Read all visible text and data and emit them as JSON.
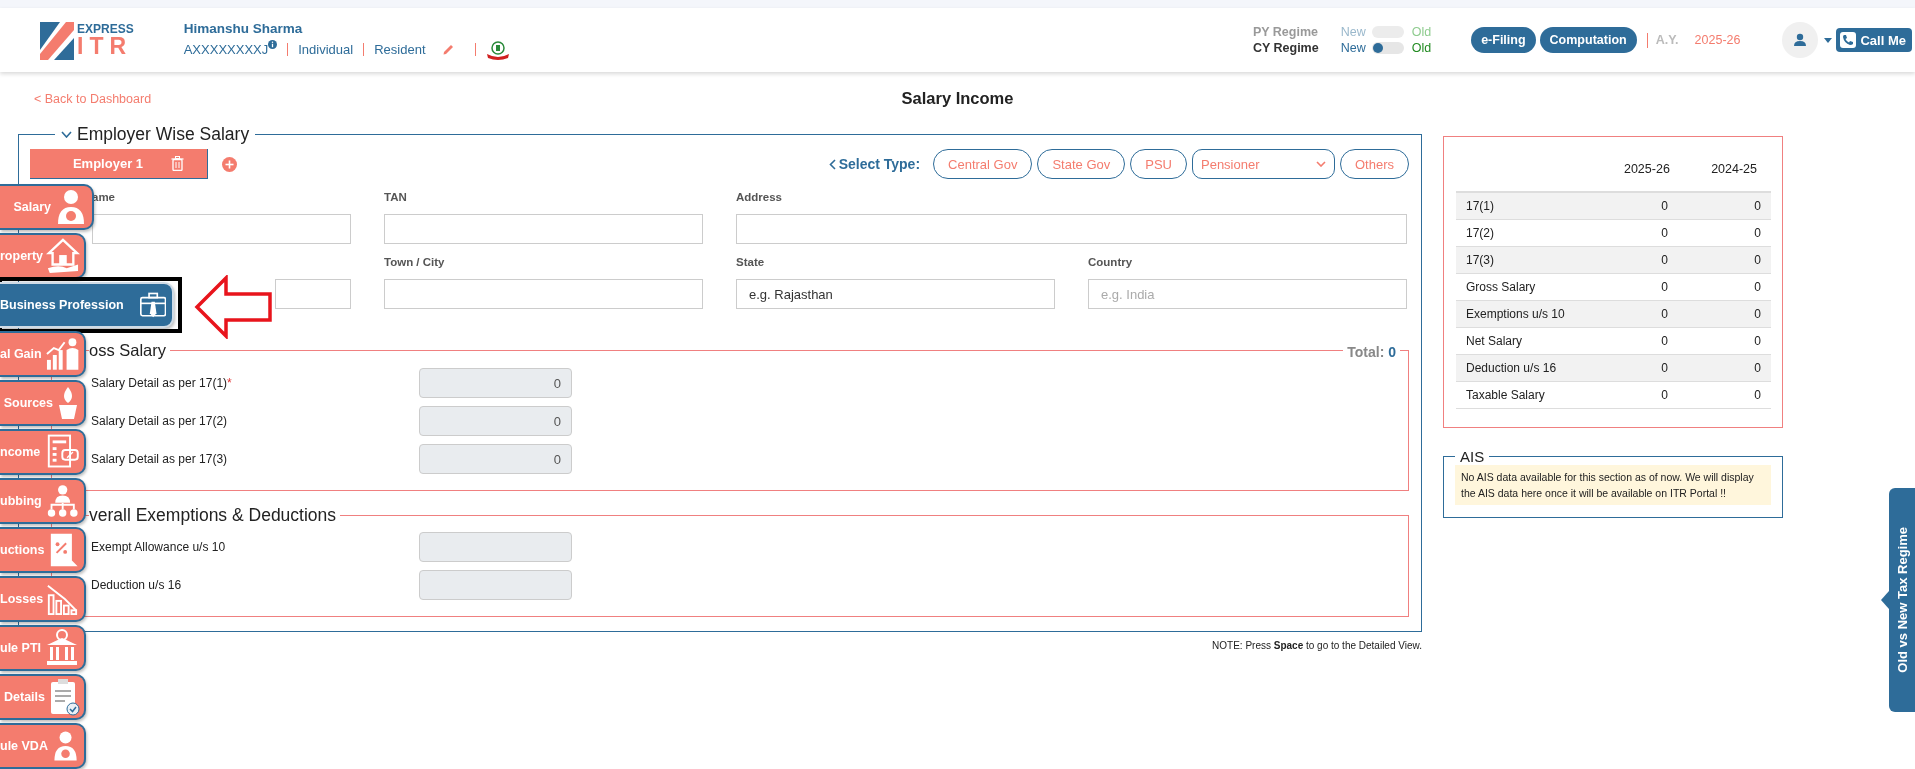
{
  "header": {
    "logo": {
      "line_1": "EXPRESS",
      "line_2": "ITR"
    },
    "user": {
      "name": "Himanshu Sharma",
      "pan": "AXXXXXXXXJ",
      "status": "Individual",
      "residency": "Resident"
    },
    "regimes": [
      {
        "label": "PY Regime",
        "new_label": "New",
        "old_label": "Old",
        "disabled": true
      },
      {
        "label": "CY Regime",
        "new_label": "New",
        "old_label": "Old",
        "disabled": false,
        "old_selected": false
      }
    ],
    "buttons": [
      "e-Filing",
      "Computation"
    ],
    "assessment_year": {
      "label": "A.Y.",
      "value": "2025-26"
    },
    "call_button": "Call Me"
  },
  "back_link": "< Back to Dashboard",
  "page_title": "Salary Income",
  "sidebar": {
    "items": [
      {
        "label": "Salary",
        "selected": false,
        "annotated": false
      },
      {
        "label": "roperty",
        "selected": false,
        "annotated": false
      },
      {
        "label": "Business Profession",
        "selected": true,
        "annotated": true
      },
      {
        "label": "al Gain",
        "selected": false,
        "annotated": false
      },
      {
        "label": "Sources",
        "selected": false,
        "annotated": false
      },
      {
        "label": "ncome",
        "selected": false,
        "annotated": false
      },
      {
        "label": "ubbing",
        "selected": false,
        "annotated": false
      },
      {
        "label": "uctions",
        "selected": false,
        "annotated": false
      },
      {
        "label": "Losses",
        "selected": false,
        "annotated": false
      },
      {
        "label": "ule PTI",
        "selected": false,
        "annotated": false
      },
      {
        "label": "Details",
        "selected": false,
        "annotated": false
      },
      {
        "label": "ule VDA",
        "selected": false,
        "annotated": false
      }
    ]
  },
  "employer_section": {
    "title": "Employer Wise Salary",
    "expanded": true,
    "employer_tabs": [
      {
        "label": "Employer 1",
        "selected": true
      }
    ],
    "select_type": {
      "label": "Select Type:",
      "options": [
        {
          "label": "Central Gov",
          "kind": "button",
          "selected": false
        },
        {
          "label": "State Gov",
          "kind": "button",
          "selected": false
        },
        {
          "label": "PSU",
          "kind": "button",
          "selected": false
        },
        {
          "label": "Pensioner",
          "kind": "dropdown",
          "selected": false
        },
        {
          "label": "Others",
          "kind": "button",
          "selected": false
        }
      ]
    },
    "field_rows": [
      [
        {
          "label": "ame"
        },
        {
          "label": "TAN"
        },
        {
          "label": "Address"
        }
      ],
      [
        {},
        {
          "label": "Town / City"
        },
        {
          "label": "State",
          "value": "e.g. Rajasthan"
        },
        {
          "label": "Country",
          "placeholder": "e.g. India"
        }
      ]
    ],
    "gross_salary": {
      "title": "oss Salary",
      "total_label": "Total:",
      "total_value": "0",
      "rows": [
        {
          "label": "Salary Detail as per 17(1)",
          "required_mark": "*",
          "value": "0"
        },
        {
          "label": "Salary Detail as per 17(2)",
          "value": "0"
        },
        {
          "label": "Salary Detail as per 17(3)",
          "value": "0"
        }
      ]
    },
    "exemptions": {
      "title": "verall Exemptions & Deductions",
      "rows": [
        {
          "label": "Exempt Allowance u/s 10"
        },
        {
          "label": "Deduction u/s 16"
        }
      ]
    },
    "note": "NOTE: Press **Space** to go to the Detailed View."
  },
  "summary": {
    "columns": [
      "2025-26",
      "2024-25"
    ],
    "rows": [
      {
        "label": "17(1)",
        "values": [
          "0",
          "0"
        ]
      },
      {
        "label": "17(2)",
        "values": [
          "0",
          "0"
        ]
      },
      {
        "label": "17(3)",
        "values": [
          "0",
          "0"
        ]
      },
      {
        "label": "Gross Salary",
        "values": [
          "0",
          "0"
        ]
      },
      {
        "label": "Exemptions u/s 10",
        "values": [
          "0",
          "0"
        ]
      },
      {
        "label": "Net Salary",
        "values": [
          "0",
          "0"
        ]
      },
      {
        "label": "Deduction u/s 16",
        "values": [
          "0",
          "0"
        ]
      },
      {
        "label": "Taxable Salary",
        "values": [
          "0",
          "0"
        ]
      }
    ]
  },
  "ais": {
    "title": "AIS",
    "message": "No AIS data available for this section as of now. We will display the AIS data here once it will be available on ITR Portal !!"
  },
  "side_tab": "Old vs New Tax Regime"
}
